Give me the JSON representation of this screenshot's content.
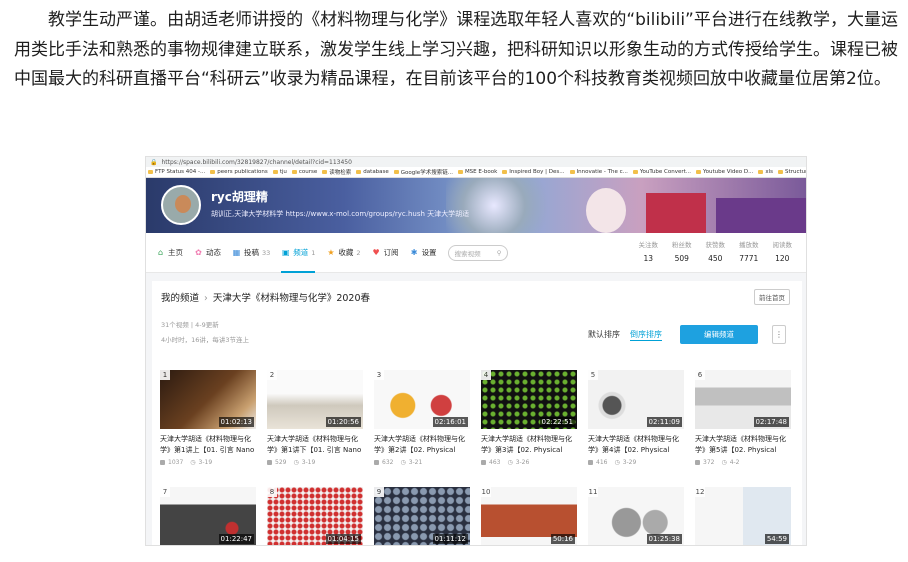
{
  "paragraph": "教学生动严谨。由胡适老师讲授的《材料物理与化学》课程选取年轻人喜欢的“bilibili”平台进行在线教学，大量运用类比手法和熟悉的事物规律建立联系，激发学生线上学习兴趣，把科研知识以形象生动的方式传授给学生。课程已被中国最大的科研直播平台“科研云”收录为精品课程，在目前该平台的100个科技教育类视频回放中收藏量位居第2位。",
  "browser": {
    "url": "https://space.bilibili.com/32819827/channel/detail?cid=113450",
    "bookmarks": [
      "FTP Status 404 -...",
      "peers publications",
      "tju",
      "course",
      "读物检索",
      "database",
      "Google学术搜索链...",
      "MSE E-book",
      "Inspired Boy | Des...",
      "Innovatie - The c...",
      "YouTube Convert...",
      "Youtube Video D...",
      "xls",
      "Structure of metal..."
    ]
  },
  "profile": {
    "username": "ryc胡理精",
    "signature": "胡训正,天津大学材料学 https://www.x-mol.com/groups/ryc.hush 天津大学胡适"
  },
  "nav": {
    "tabs": [
      {
        "label": "主页",
        "count": "",
        "icon": "home-icon"
      },
      {
        "label": "动态",
        "count": "",
        "icon": "activity-icon"
      },
      {
        "label": "投稿",
        "count": "33",
        "icon": "upload-icon"
      },
      {
        "label": "频道",
        "count": "1",
        "icon": "channel-icon"
      },
      {
        "label": "收藏",
        "count": "2",
        "icon": "star-icon"
      },
      {
        "label": "订阅",
        "count": "",
        "icon": "heart-icon"
      },
      {
        "label": "设置",
        "count": "",
        "icon": "gear-icon"
      }
    ],
    "search_placeholder": "搜索视频",
    "stats": [
      {
        "label": "关注数",
        "value": "13"
      },
      {
        "label": "粉丝数",
        "value": "509"
      },
      {
        "label": "获赞数",
        "value": "450"
      },
      {
        "label": "播放数",
        "value": "7771"
      },
      {
        "label": "阅读数",
        "value": "120"
      }
    ]
  },
  "channel": {
    "breadcrumb_root": "我的频道",
    "title": "天津大学《材料物理与化学》2020春",
    "back_label": "前往首页",
    "meta1": "31个视频 | 4-9更新",
    "meta2": "4小时时，16讲，每讲3节连上",
    "sort_default": "默认排序",
    "sort_upload": "倒序排序",
    "edit_label": "编辑频道",
    "more_label": "⋮"
  },
  "videos": [
    {
      "num": "1",
      "duration": "01:02:13",
      "title": "天津大学胡适《材料物理与化学》第1讲上【01. 引言 Nano",
      "views": "1037",
      "date": "3-19"
    },
    {
      "num": "2",
      "duration": "01:20:56",
      "title": "天津大学胡适《材料物理与化学》第1讲下【01. 引言 Nano",
      "views": "529",
      "date": "3-19"
    },
    {
      "num": "3",
      "duration": "02:16:01",
      "title": "天津大学胡适《材料物理与化学》第2讲【02. Physical",
      "views": "632",
      "date": "3-21"
    },
    {
      "num": "4",
      "duration": "02:22:51",
      "title": "天津大学胡适《材料物理与化学》第3讲【02. Physical",
      "views": "463",
      "date": "3-26"
    },
    {
      "num": "5",
      "duration": "02:11:09",
      "title": "天津大学胡适《材料物理与化学》第4讲【02. Physical",
      "views": "416",
      "date": "3-29"
    },
    {
      "num": "6",
      "duration": "02:17:48",
      "title": "天津大学胡适《材料物理与化学》第5讲【02. Physical",
      "views": "372",
      "date": "4-2"
    },
    {
      "num": "7",
      "duration": "01:22:47",
      "title": "",
      "views": "",
      "date": ""
    },
    {
      "num": "8",
      "duration": "01:04:15",
      "title": "",
      "views": "",
      "date": ""
    },
    {
      "num": "9",
      "duration": "01:11:12",
      "title": "",
      "views": "",
      "date": ""
    },
    {
      "num": "10",
      "duration": "50:16",
      "title": "",
      "views": "",
      "date": ""
    },
    {
      "num": "11",
      "duration": "01:25:38",
      "title": "",
      "views": "",
      "date": ""
    },
    {
      "num": "12",
      "duration": "54:59",
      "title": "",
      "views": "",
      "date": ""
    }
  ],
  "colors": {
    "accent": "#00a1d6",
    "button": "#1ea1e0"
  }
}
